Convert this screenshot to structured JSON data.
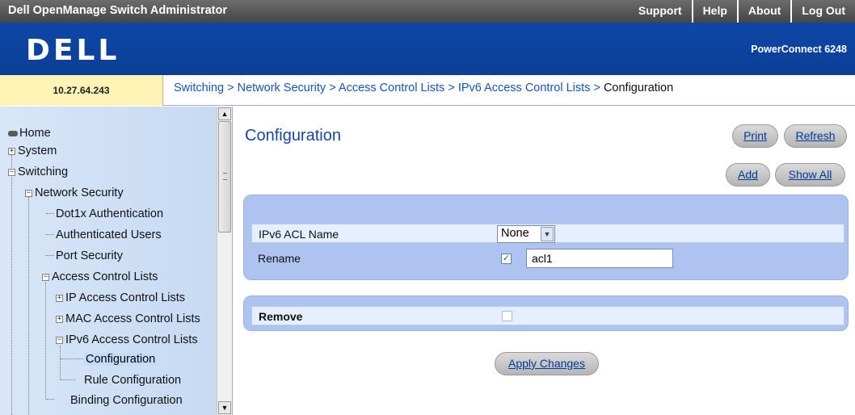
{
  "header": {
    "app_title": "Dell OpenManage Switch Administrator",
    "links": [
      "Support",
      "Help",
      "About",
      "Log Out"
    ],
    "logo": "DELL",
    "product": "PowerConnect 6248"
  },
  "ip_address": "10.27.64.243",
  "breadcrumb": {
    "items": [
      "Switching",
      "Network Security",
      "Access Control Lists",
      "IPv6 Access Control Lists"
    ],
    "current": "Configuration",
    "separator": ">"
  },
  "nav": {
    "home": "Home",
    "system": "System",
    "switching": "Switching",
    "network_security": "Network Security",
    "dot1x": "Dot1x Authentication",
    "auth_users": "Authenticated Users",
    "port_security": "Port Security",
    "acl": "Access Control Lists",
    "ip_acl": "IP Access Control Lists",
    "mac_acl": "MAC Access Control Lists",
    "ipv6_acl": "IPv6 Access Control Lists",
    "configuration": "Configuration",
    "rule_configuration": "Rule Configuration",
    "binding_configuration": "Binding Configuration"
  },
  "main": {
    "title": "Configuration",
    "buttons": {
      "print": "Print",
      "refresh": "Refresh",
      "add": "Add",
      "show_all": "Show All",
      "apply": "Apply Changes"
    },
    "form": {
      "acl_name_label": "IPv6 ACL Name",
      "acl_name_value": "None",
      "rename_label": "Rename",
      "rename_checked": true,
      "rename_value": "acl1",
      "remove_label": "Remove",
      "remove_checked": false
    }
  }
}
